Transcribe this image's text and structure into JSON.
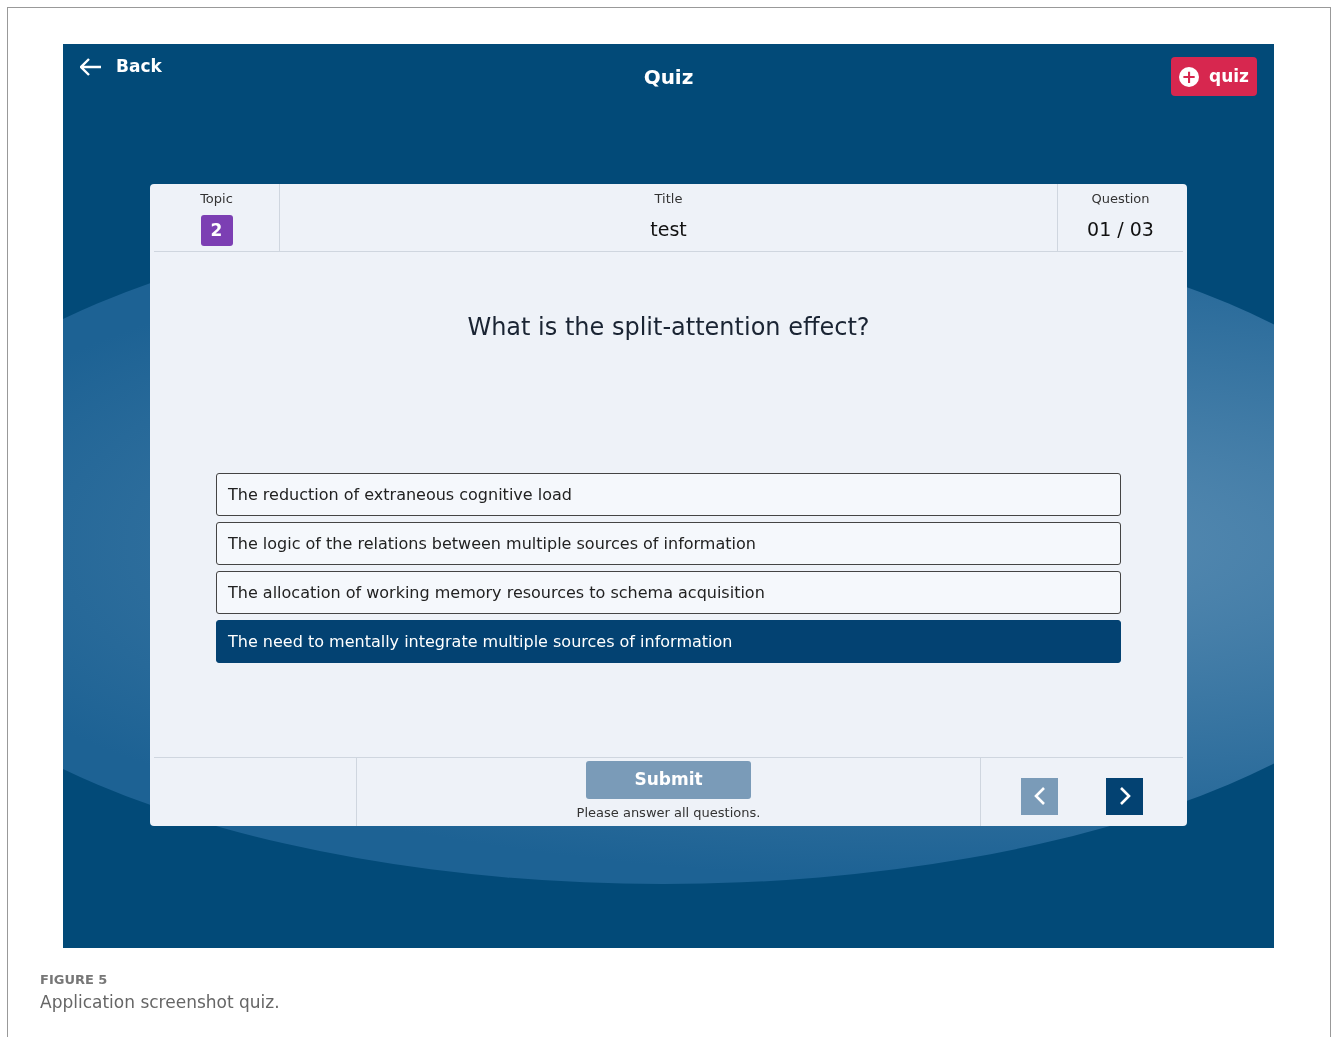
{
  "header": {
    "back_label": "Back",
    "title": "Quiz",
    "add_button": {
      "icon": "+",
      "label": "quiz"
    }
  },
  "quiz_info": {
    "topic_label": "Topic",
    "topic": "2",
    "title_label": "Title",
    "title": "test",
    "question_label": "Question",
    "question_counter": "01 / 03"
  },
  "question": "What is the split-attention effect?",
  "options": [
    {
      "text": "The reduction of extraneous cognitive load",
      "selected": false
    },
    {
      "text": "The logic of the relations between multiple sources of information",
      "selected": false
    },
    {
      "text": "The allocation of working memory resources to schema acquisition",
      "selected": false
    },
    {
      "text": "The need to mentally integrate multiple sources of information",
      "selected": true
    }
  ],
  "footer": {
    "submit": {
      "label": "Submit",
      "disabled": true
    },
    "hint": "Please answer all questions.",
    "prev_disabled": true,
    "next_disabled": false
  },
  "caption": {
    "figure": "FIGURE 5",
    "text": "Application screenshot quiz."
  }
}
